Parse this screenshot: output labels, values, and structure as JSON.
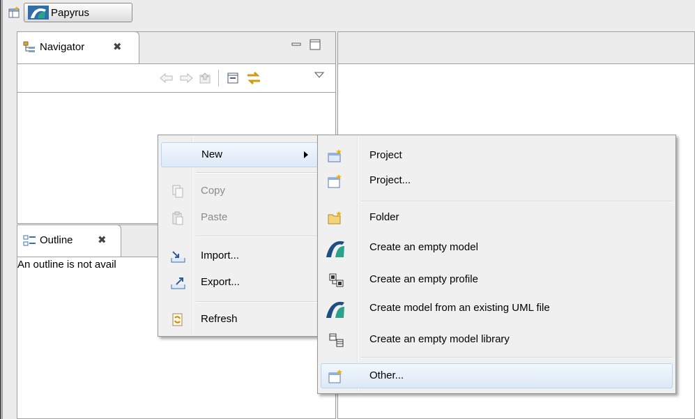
{
  "perspective": {
    "button_label": "Papyrus"
  },
  "navigator": {
    "tab_label": "Navigator",
    "close_glyph": "✖"
  },
  "outline": {
    "tab_label": "Outline",
    "close_glyph": "✖",
    "message": "An outline is not avail"
  },
  "context_menu": {
    "items": [
      {
        "label": "New",
        "icon": "",
        "enabled": true,
        "highlighted": true,
        "has_submenu": true
      },
      {
        "label": "Copy",
        "icon": "copy-icon",
        "enabled": false
      },
      {
        "label": "Paste",
        "icon": "paste-icon",
        "enabled": false
      },
      {
        "label": "Import...",
        "icon": "import-icon",
        "enabled": true
      },
      {
        "label": "Export...",
        "icon": "export-icon",
        "enabled": true
      },
      {
        "label": "Refresh",
        "icon": "refresh-icon",
        "enabled": true
      }
    ]
  },
  "submenu": {
    "items": [
      {
        "label": "Project",
        "icon": "new-project-icon"
      },
      {
        "label": "Project...",
        "icon": "new-project-wizard-icon"
      },
      {
        "label": "Folder",
        "icon": "new-folder-icon"
      },
      {
        "label": "Create an empty model",
        "icon": "papyrus-model-icon"
      },
      {
        "label": "Create an empty profile",
        "icon": "uml-profile-icon"
      },
      {
        "label": "Create model from an existing UML file",
        "icon": "papyrus-model-icon"
      },
      {
        "label": "Create an empty model library",
        "icon": "model-library-icon"
      },
      {
        "label": "Other...",
        "icon": "new-wizard-icon",
        "highlighted": true
      }
    ]
  },
  "colors": {
    "menu_bg": "#f0f0f0",
    "highlight": "#dde9f7",
    "disabled_text": "#8a8a8a"
  }
}
